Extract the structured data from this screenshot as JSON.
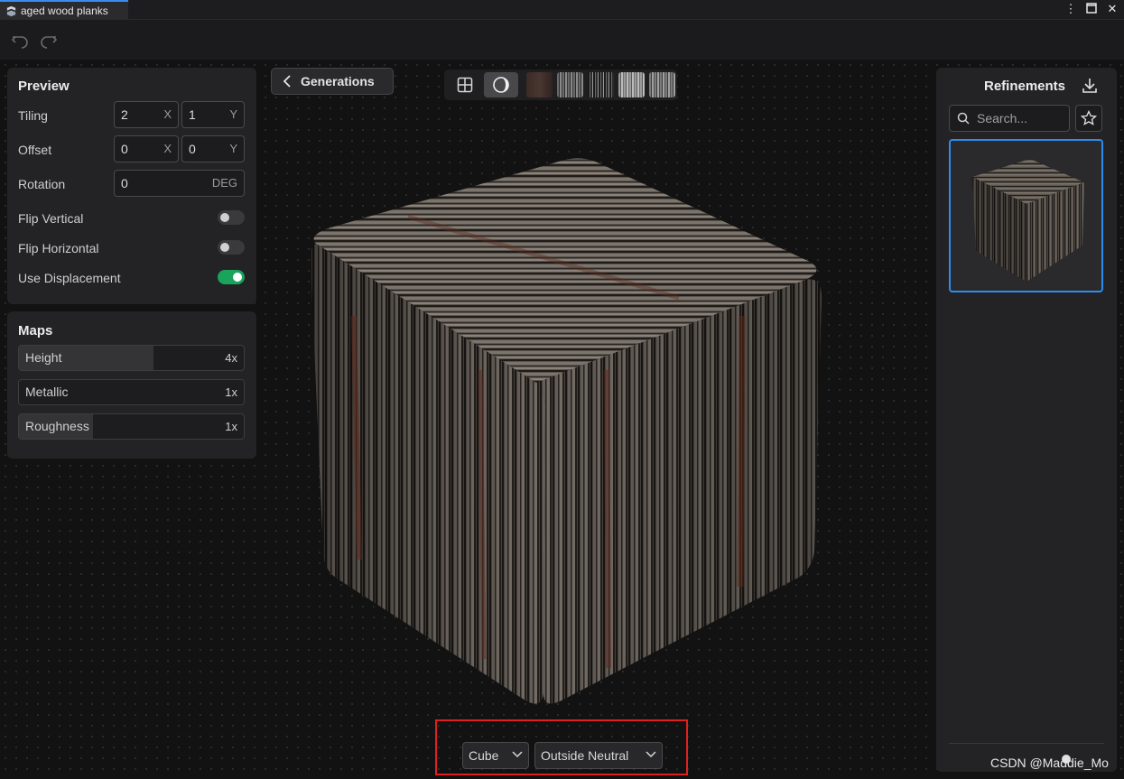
{
  "window": {
    "tab_title": "aged wood planks",
    "controls": [
      "more-vertical-icon",
      "maximize-icon",
      "close-icon"
    ]
  },
  "toolbar": {
    "undo_icon": "undo-icon",
    "redo_icon": "redo-icon"
  },
  "preview": {
    "title": "Preview",
    "tiling": {
      "label": "Tiling",
      "x": "2",
      "x_unit": "X",
      "y": "1",
      "y_unit": "Y"
    },
    "offset": {
      "label": "Offset",
      "x": "0",
      "x_unit": "X",
      "y": "0",
      "y_unit": "Y"
    },
    "rotation": {
      "label": "Rotation",
      "value": "0",
      "unit": "DEG"
    },
    "flip_vertical": {
      "label": "Flip Vertical",
      "on": false
    },
    "flip_horizontal": {
      "label": "Flip Horizontal",
      "on": false
    },
    "use_displacement": {
      "label": "Use Displacement",
      "on": true
    }
  },
  "maps": {
    "title": "Maps",
    "items": [
      {
        "name": "Height",
        "value": "4x",
        "fill": 0.6
      },
      {
        "name": "Metallic",
        "value": "1x",
        "fill": 0.0
      },
      {
        "name": "Roughness",
        "value": "1x",
        "fill": 0.33
      }
    ]
  },
  "generations_button": {
    "label": "Generations"
  },
  "view_switch": {
    "buttons": [
      "grid-view-icon",
      "material-sphere-icon"
    ],
    "active": "material-sphere-icon",
    "texture_thumbnails": [
      "albedo-thumbnail",
      "height-thumbnail",
      "normal-thumbnail",
      "roughness-thumbnail",
      "metallic-thumbnail"
    ]
  },
  "viewer": {
    "shape_select": "Cube",
    "environment_select": "Outside Neutral"
  },
  "refinements": {
    "title": "Refinements",
    "search_placeholder": "Search...",
    "download_icon": "download-icon",
    "favorite_icon": "star-icon"
  },
  "watermark": "CSDN @Maddie_Mo",
  "colors": {
    "accent_blue": "#2d8cf0",
    "toggle_on_green": "#1aa35a",
    "highlight_red": "#e02020",
    "panel_bg": "#232325"
  }
}
